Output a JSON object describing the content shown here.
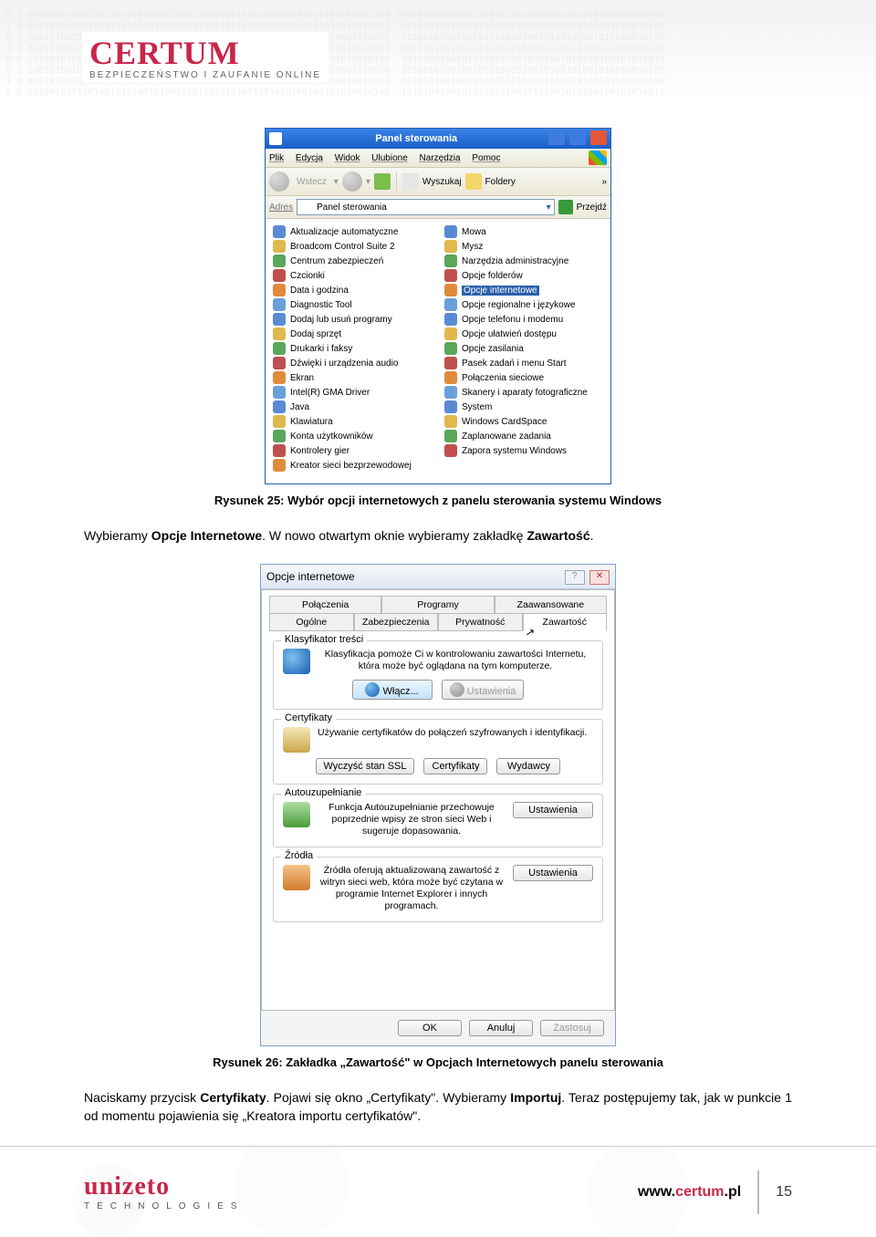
{
  "header": {
    "brand": "CERTUM",
    "tagline": "BEZPIECZEŃSTWO I ZAUFANIE ONLINE"
  },
  "figure1": {
    "window_title": "Panel sterowania",
    "menu": {
      "plik": "Plik",
      "edycja": "Edycja",
      "widok": "Widok",
      "ulubione": "Ulubione",
      "narzedzia": "Narzędzia",
      "pomoc": "Pomoc"
    },
    "toolbar": {
      "back": "Wstecz",
      "search": "Wyszukaj",
      "folders": "Foldery",
      "more": "»"
    },
    "address": {
      "label": "Adres",
      "value": "Panel sterowania",
      "go": "Przejdź"
    },
    "left_items": [
      "Aktualizacje automatyczne",
      "Broadcom Control Suite 2",
      "Centrum zabezpieczeń",
      "Czcionki",
      "Data i godzina",
      "Diagnostic Tool",
      "Dodaj lub usuń programy",
      "Dodaj sprzęt",
      "Drukarki i faksy",
      "Dźwięki i urządzenia audio",
      "Ekran",
      "Intel(R) GMA Driver",
      "Java",
      "Klawiatura",
      "Konta użytkowników",
      "Kontrolery gier",
      "Kreator sieci bezprzewodowej"
    ],
    "right_items": [
      "Mowa",
      "Mysz",
      "Narzędzia administracyjne",
      "Opcje folderów",
      "Opcje internetowe",
      "Opcje regionalne i językowe",
      "Opcje telefonu i modemu",
      "Opcje ułatwień dostępu",
      "Opcje zasilania",
      "Pasek zadań i menu Start",
      "Połączenia sieciowe",
      "Skanery i aparaty fotograficzne",
      "System",
      "Windows CardSpace",
      "Zaplanowane zadania",
      "Zapora systemu Windows"
    ],
    "caption": "Rysunek 25: Wybór opcji internetowych z panelu sterowania systemu Windows"
  },
  "paragraph1": {
    "pre": "Wybieramy ",
    "b1": "Opcje Internetowe",
    "mid": ". W nowo otwartym oknie wybieramy zakładkę ",
    "b2": "Zawartość",
    "end": "."
  },
  "figure2": {
    "title": "Opcje internetowe",
    "tabs_top": {
      "polaczenia": "Połączenia",
      "programy": "Programy",
      "zaawansowane": "Zaawansowane"
    },
    "tabs_bottom": {
      "ogolne": "Ogólne",
      "zabezpieczenia": "Zabezpieczenia",
      "prywatnosc": "Prywatność",
      "zawartosc": "Zawartość"
    },
    "grp_klas": {
      "label": "Klasyfikator treści",
      "text": "Klasyfikacja pomoże Ci w kontrolowaniu zawartości Internetu, która może być oglądana na tym komputerze.",
      "btn_enable": "Włącz...",
      "btn_settings": "Ustawienia"
    },
    "grp_cert": {
      "label": "Certyfikaty",
      "text": "Używanie certyfikatów do połączeń szyfrowanych i identyfikacji.",
      "btn_clear": "Wyczyść stan SSL",
      "btn_certs": "Certyfikaty",
      "btn_pub": "Wydawcy"
    },
    "grp_auto": {
      "label": "Autouzupełnianie",
      "text": "Funkcja Autouzupełnianie przechowuje poprzednie wpisy ze stron sieci Web i sugeruje dopasowania.",
      "btn": "Ustawienia"
    },
    "grp_feed": {
      "label": "Źródła",
      "text": "Źródła oferują aktualizowaną zawartość z witryn sieci web, która może być czytana w programie Internet Explorer i innych programach.",
      "btn": "Ustawienia"
    },
    "foot": {
      "ok": "OK",
      "cancel": "Anuluj",
      "apply": "Zastosuj"
    },
    "caption": "Rysunek 26: Zakładka „Zawartość\" w Opcjach Internetowych panelu sterowania"
  },
  "paragraph2": {
    "p1": "Naciskamy przycisk ",
    "b1": "Certyfikaty",
    "p2": ". Pojawi się okno „Certyfikaty\". Wybieramy ",
    "b2": "Importuj",
    "p3": ". Teraz postępujemy tak, jak w punkcie 1 od momentu pojawienia się „Kreatora importu certyfikatów\"."
  },
  "footer": {
    "brand": "unizeto",
    "tag": "TECHNOLOGIES",
    "url_pre": "www.",
    "url_main": "certum",
    "url_post": ".pl",
    "page": "15"
  }
}
